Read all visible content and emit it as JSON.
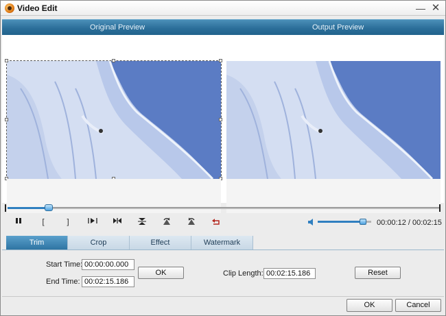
{
  "window": {
    "title": "Video Edit",
    "minimize_glyph": "—",
    "close_glyph": "✕"
  },
  "preview": {
    "original_label": "Original Preview",
    "output_label": "Output Preview"
  },
  "playback": {
    "progress": 0.095,
    "volume": 0.85,
    "timecode": "00:00:12 / 00:02:15",
    "controls": [
      {
        "name": "pause-button",
        "icon": "pause-icon",
        "glyph": "II"
      },
      {
        "name": "set-start-button",
        "icon": "bracket-open-icon",
        "glyph": "["
      },
      {
        "name": "set-end-button",
        "icon": "bracket-close-icon",
        "glyph": "]"
      },
      {
        "name": "next-frame-button",
        "icon": "step-forward-icon"
      },
      {
        "name": "to-end-button",
        "icon": "skip-end-icon"
      },
      {
        "name": "flip-vertical-button",
        "icon": "flip-vertical-icon"
      },
      {
        "name": "rotate-right-button",
        "icon": "rotate-right-icon"
      },
      {
        "name": "rotate-left-button",
        "icon": "rotate-left-icon"
      },
      {
        "name": "undo-button",
        "icon": "undo-icon"
      }
    ]
  },
  "tabs": [
    {
      "label": "Trim",
      "active": true
    },
    {
      "label": "Crop",
      "active": false
    },
    {
      "label": "Effect",
      "active": false
    },
    {
      "label": "Watermark",
      "active": false
    }
  ],
  "trim": {
    "start_time_label": "Start Time:",
    "start_time_value": "00:00:00.000",
    "end_time_label": "End Time:",
    "end_time_value": "00:02:15.186",
    "ok_label": "OK",
    "clip_length_label": "Clip Length:",
    "clip_length_value": "00:02:15.186",
    "reset_label": "Reset"
  },
  "footer": {
    "ok_label": "OK",
    "cancel_label": "Cancel"
  },
  "colors": {
    "header_blue": "#2c6f9a",
    "accent_blue": "#2f7fc0",
    "video_sky": "#5b7cc4"
  }
}
